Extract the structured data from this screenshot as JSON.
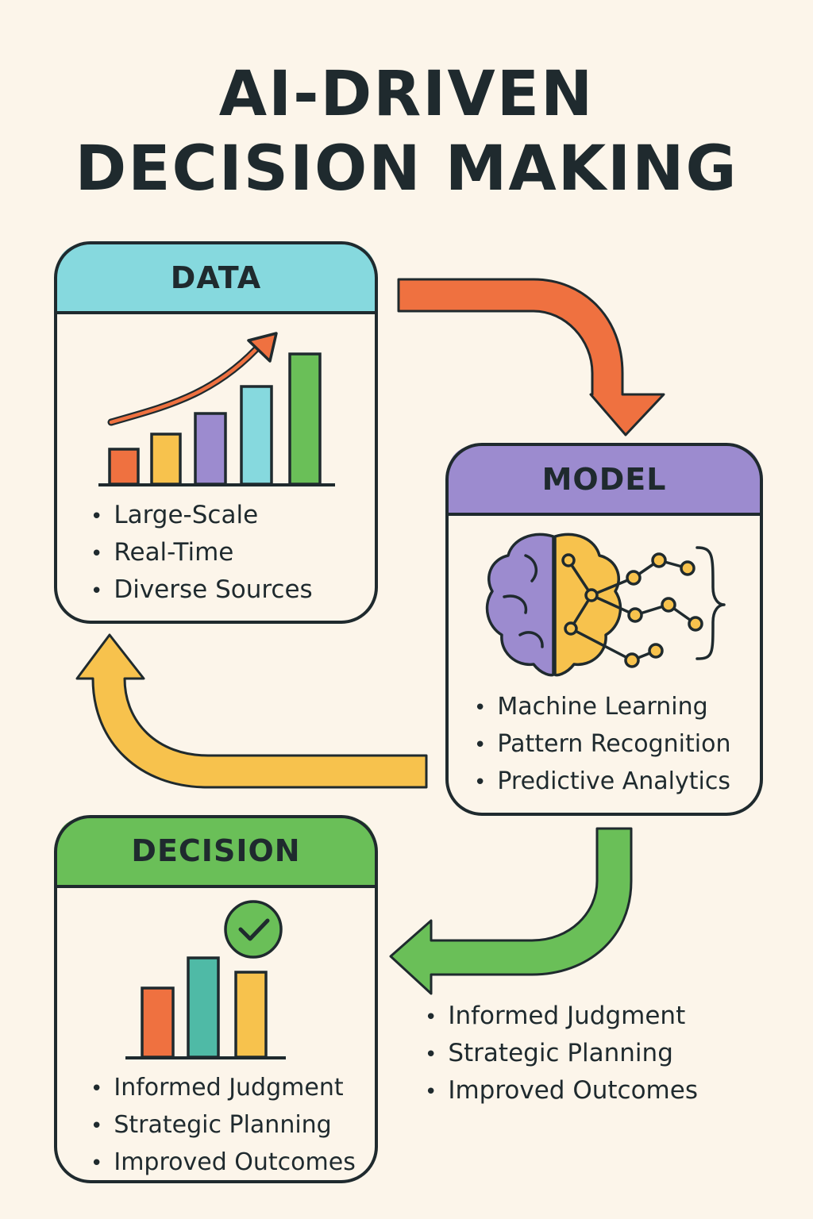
{
  "title": {
    "line1": "AI-DRIVEN",
    "line2": "DECISION MAKING"
  },
  "colors": {
    "background": "#fcf5ea",
    "outline": "#1f2a2e",
    "data_header": "#86d9de",
    "model_header": "#9c8bcf",
    "decision_header": "#6abf58",
    "orange": "#ef7140",
    "yellow": "#f7c24d",
    "purple": "#9c8bcf",
    "teal": "#86d9de",
    "green": "#6abf58"
  },
  "cards": {
    "data": {
      "title": "DATA",
      "icon": "bar-chart-with-rising-arrow",
      "items": [
        "Large-Scale",
        "Real-Time",
        "Diverse Sources"
      ]
    },
    "model": {
      "title": "MODEL",
      "icon": "brain-network",
      "items": [
        "Machine Learning",
        "Pattern Recognition",
        "Predictive Analytics"
      ]
    },
    "decision": {
      "title": "DECISION",
      "icon": "bar-chart-with-checkmark",
      "items": [
        "Informed Judgment",
        "Strategic Planning",
        "Improved Outcomes"
      ]
    }
  },
  "outcomes": {
    "items": [
      "Informed Judgment",
      "Strategic Planning",
      "Improved Outcomes"
    ]
  },
  "arrows": {
    "data_to_model": "orange",
    "model_to_data": "yellow",
    "model_to_decision": "green"
  }
}
